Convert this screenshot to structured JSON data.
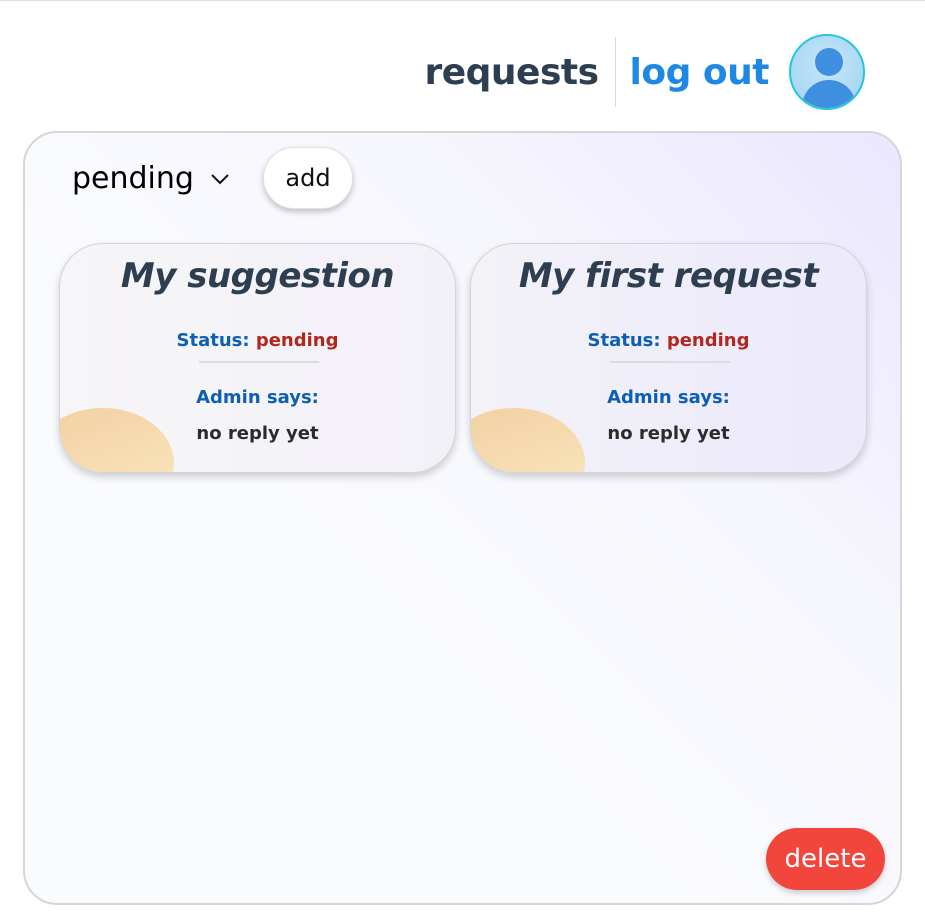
{
  "header": {
    "requests_label": "requests",
    "logout_label": "log out",
    "avatar_icon": "user-avatar-icon"
  },
  "toolbar": {
    "filter_value": "pending",
    "filter_icon": "chevron-down-icon",
    "add_label": "add"
  },
  "cards": [
    {
      "title": "My suggestion",
      "status_label": "Status:",
      "status_value": "pending",
      "admin_label": "Admin says:",
      "admin_reply": "no reply yet"
    },
    {
      "title": "My first request",
      "status_label": "Status:",
      "status_value": "pending",
      "admin_label": "Admin says:",
      "admin_reply": "no reply yet"
    }
  ],
  "actions": {
    "delete_label": "delete"
  },
  "colors": {
    "link_blue": "#1e88e5",
    "title_dark": "#2c3e50",
    "status_label_blue": "#0d5fb3",
    "status_value_red": "#b3261e",
    "delete_red": "#f2463d",
    "avatar_ring": "#26c6da"
  }
}
